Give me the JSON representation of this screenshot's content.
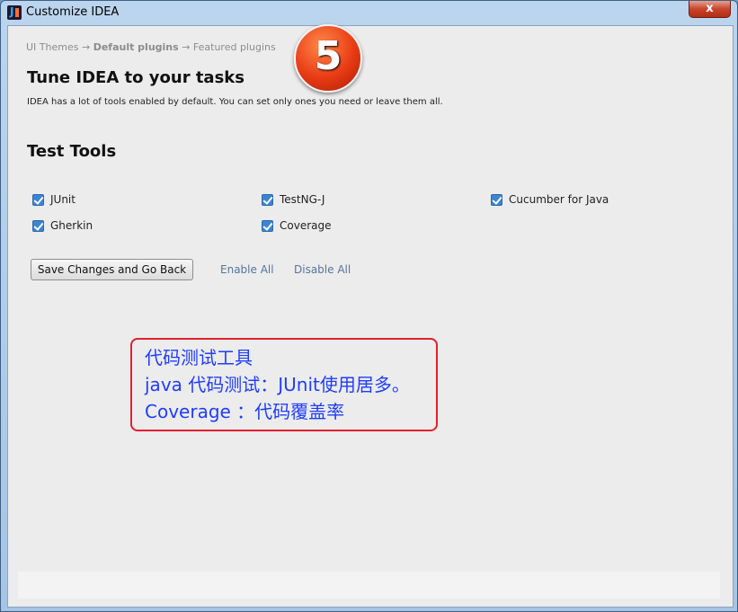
{
  "window": {
    "title": "Customize IDEA",
    "close_label": "x"
  },
  "breadcrumb": {
    "step1": "UI Themes",
    "sep1": "→",
    "step2": "Default plugins",
    "sep2": "→",
    "step3": "Featured plugins"
  },
  "step_badge": "5",
  "page": {
    "title": "Tune IDEA to your tasks",
    "description": "IDEA has a lot of tools enabled by default. You can set only ones you need or leave them all."
  },
  "section": {
    "title": "Test Tools",
    "items": [
      {
        "label": "JUnit",
        "checked": true
      },
      {
        "label": "TestNG-J",
        "checked": true
      },
      {
        "label": "Cucumber for Java",
        "checked": true
      },
      {
        "label": "Gherkin",
        "checked": true
      },
      {
        "label": "Coverage",
        "checked": true
      }
    ]
  },
  "actions": {
    "save_label": "Save Changes and Go Back",
    "enable_all": "Enable All",
    "disable_all": "Disable All"
  },
  "annotation": {
    "line1": "代码测试工具",
    "line2": "java 代码测试：JUnit使用居多。",
    "line3": "Coverage  ：代码覆盖率"
  },
  "colors": {
    "accent_checkbox": "#3c84d4",
    "link": "#55759a",
    "annotation_text": "#1f3cff",
    "annotation_border": "#e2202c"
  }
}
